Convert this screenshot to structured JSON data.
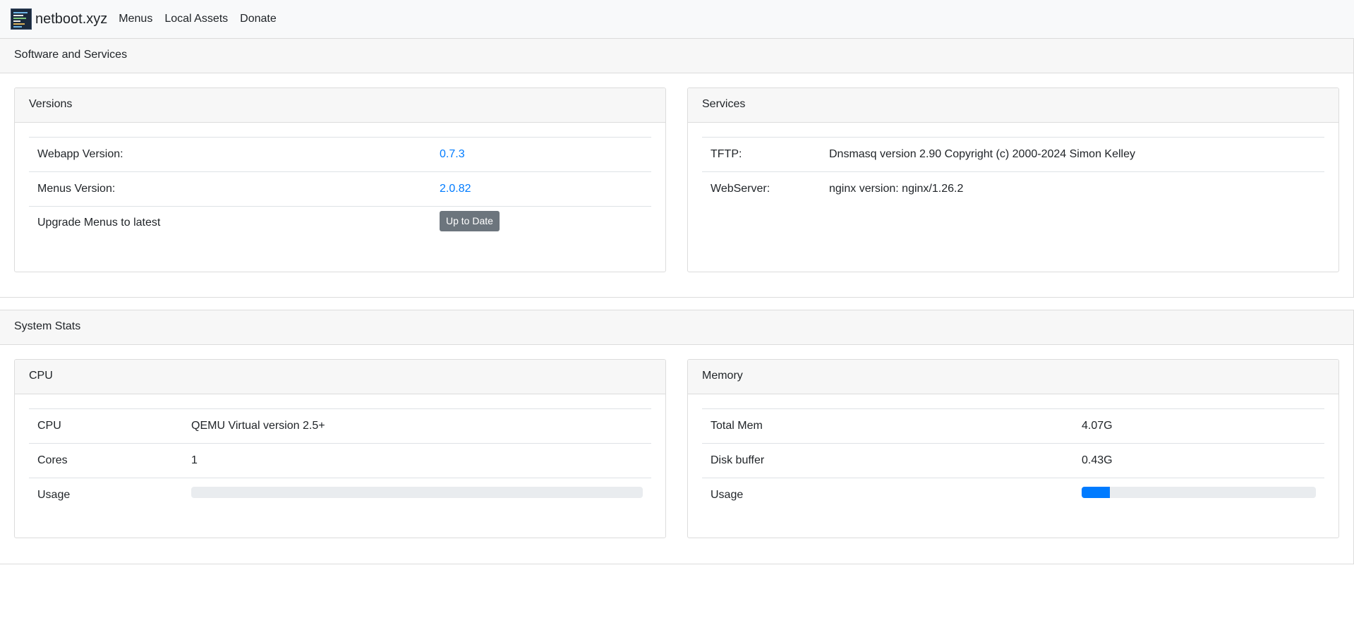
{
  "navbar": {
    "brand": "netboot.xyz",
    "links": [
      "Menus",
      "Local Assets",
      "Donate"
    ]
  },
  "software": {
    "title": "Software and Services",
    "versions": {
      "title": "Versions",
      "webapp_label": "Webapp Version:",
      "webapp_value": "0.7.3",
      "menus_label": "Menus Version:",
      "menus_value": "2.0.82",
      "upgrade_label": "Upgrade Menus to latest",
      "upgrade_button": "Up to Date"
    },
    "services": {
      "title": "Services",
      "tftp_label": "TFTP:",
      "tftp_value": "Dnsmasq version 2.90 Copyright (c) 2000-2024 Simon Kelley",
      "web_label": "WebServer:",
      "web_value": "nginx version: nginx/1.26.2"
    }
  },
  "stats": {
    "title": "System Stats",
    "cpu": {
      "title": "CPU",
      "cpu_label": "CPU",
      "cpu_value": "QEMU Virtual version 2.5+",
      "cores_label": "Cores",
      "cores_value": "1",
      "usage_label": "Usage",
      "usage_percent": 0
    },
    "memory": {
      "title": "Memory",
      "total_label": "Total Mem",
      "total_value": "4.07G",
      "buffer_label": "Disk buffer",
      "buffer_value": "0.43G",
      "usage_label": "Usage",
      "usage_percent": 12
    }
  },
  "colors": {
    "link": "#007bff",
    "button": "#6c757d",
    "progress": "#007bff"
  }
}
